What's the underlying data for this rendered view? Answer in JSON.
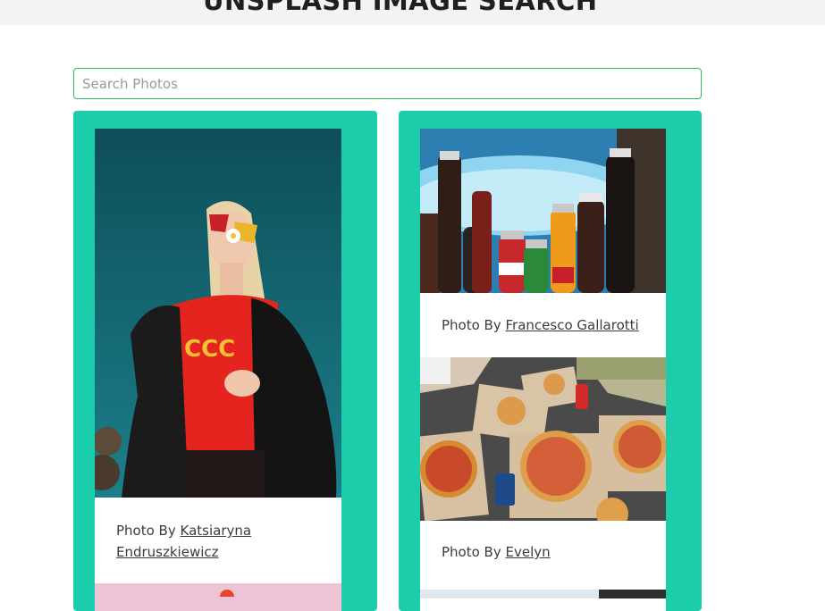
{
  "header": {
    "title": "UNSPLASH IMAGE SEARCH"
  },
  "search": {
    "placeholder": "Search Photos",
    "value": ""
  },
  "cards": [
    {
      "credit_prefix": "Photo By",
      "author": "Katsiaryna Endruszkiewicz",
      "image": "woman-with-heart-sunglasses-photo"
    },
    {
      "credit_prefix": "Photo By",
      "author": "Francesco Gallarotti",
      "image": "soda-bottles-in-ice-bucket-photo"
    },
    {
      "credit_prefix": "Photo By",
      "author": "Evelyn",
      "image": "pizza-boxes-on-floor-photo"
    }
  ],
  "colors": {
    "accent": "#1ccdac",
    "search_border": "#2ebd63",
    "header_bg": "#f3f3f3"
  }
}
